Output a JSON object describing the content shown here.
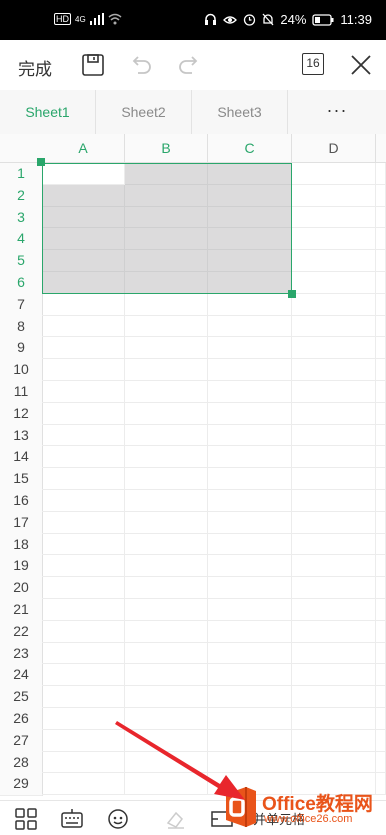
{
  "status_bar": {
    "hd": "HD",
    "network": "4G",
    "battery": "24%",
    "time": "11:39"
  },
  "toolbar": {
    "done_label": "完成",
    "page_count": "16"
  },
  "tabs": [
    {
      "label": "Sheet1",
      "active": true
    },
    {
      "label": "Sheet2",
      "active": false
    },
    {
      "label": "Sheet3",
      "active": false
    }
  ],
  "more_label": "···",
  "columns": [
    "A",
    "B",
    "C",
    "D"
  ],
  "rows": [
    "1",
    "2",
    "3",
    "4",
    "5",
    "6",
    "7",
    "8",
    "9",
    "10",
    "11",
    "12",
    "13",
    "14",
    "15",
    "16",
    "17",
    "18",
    "19",
    "20",
    "21",
    "22",
    "23",
    "24",
    "25",
    "26",
    "27",
    "28",
    "29"
  ],
  "selection": {
    "start": "A1",
    "end": "C6"
  },
  "colors": {
    "accent": "#2aa66b",
    "selection_fill": "#dcdbdc",
    "arrow": "#e8262c",
    "watermark_orange": "#e9541a"
  },
  "bottom_bar": {
    "partial_label": "合并单元格"
  },
  "watermark": {
    "brand": "Office教程网",
    "url": "www.office26.com"
  }
}
